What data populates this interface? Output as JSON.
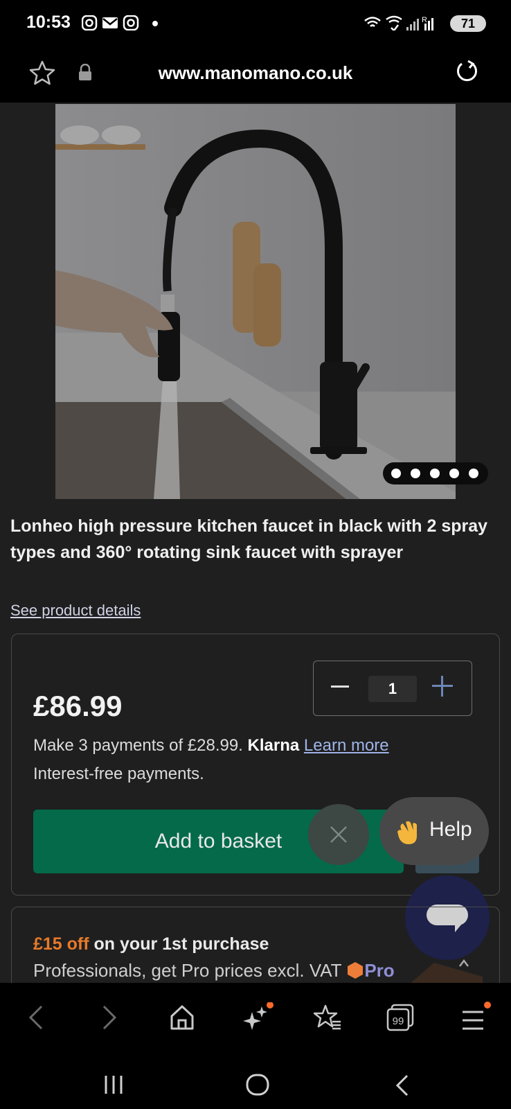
{
  "status": {
    "time": "10:53",
    "battery": "71"
  },
  "browser": {
    "url": "www.manomano.co.uk"
  },
  "product": {
    "title": "Lonheo high pressure kitchen faucet in black with 2 spray types and 360° rotating sink faucet with sprayer",
    "details_link": "See product details",
    "image_count": 5,
    "active_image": 1,
    "price": "£86.99",
    "quantity": "1",
    "klarna_text": "Make 3 payments of £28.99.",
    "klarna_brand": "Klarna",
    "learn_more": "Learn more",
    "interest_free": "Interest-free payments.",
    "add_to_basket": "Add to basket"
  },
  "help": {
    "label": "Help"
  },
  "promo": {
    "amount": "£15 off",
    "title_rest": " on your 1st purchase",
    "subtitle": "Professionals, get Pro prices excl. VAT",
    "pro_label": "Pro"
  },
  "icons": {
    "status": [
      "instagram-icon",
      "mail-icon",
      "instagram-icon",
      "notification-dot-icon",
      "wifi-icon",
      "wifi-calling-icon",
      "signal-icon",
      "roaming-signal-icon",
      "battery-icon"
    ],
    "browser_nav": [
      "back-icon",
      "forward-icon",
      "home-icon",
      "sparkle-icon",
      "favorites-icon",
      "tabs-icon",
      "menu-icon"
    ],
    "system_nav": [
      "recents-icon",
      "home-circle-icon",
      "system-back-icon"
    ]
  },
  "tabs_count": "99",
  "colors": {
    "accent_green": "#046a4a",
    "promo_orange": "#e87a2a",
    "link_blue": "#9fb4ea",
    "notification_orange": "#ff6a2b",
    "chat_navy": "#1e214a"
  }
}
